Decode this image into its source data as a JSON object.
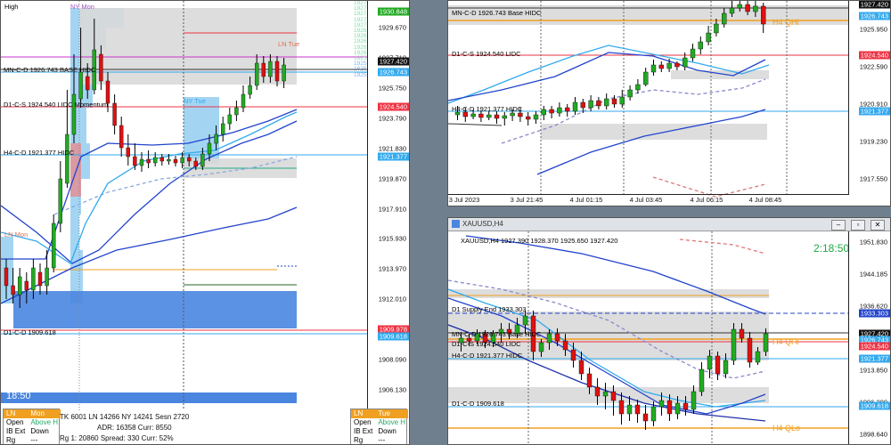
{
  "colors": {
    "bull": "#22aa22",
    "bear": "#dd1111",
    "blue": "#2244cc",
    "lightblue": "#33aaee",
    "orange": "#f0a020",
    "red": "#ee3344",
    "gray": "#d9d9d9",
    "zoneblue": "#4a86e0",
    "magenta": "#cc33cc",
    "hist": "#8ccbf0"
  },
  "left": {
    "high_label": "High",
    "ny_label": "NY Mon",
    "ln_tue_label": "LN Tue",
    "ny_tue_label": "NY Tue",
    "ln_mon_label": "LN Mon",
    "timer": "18:50",
    "zone_labels": [
      {
        "text": "MN-C-D 1926.743 BASE HIDC",
        "color": "#000"
      },
      {
        "text": "D1-C-S 1924.540 LIDC Momentum",
        "color": "#000"
      },
      {
        "text": "H4-C-D 1921.377 HIDC",
        "color": "#000"
      },
      {
        "text": "D1-C-D 1909.618",
        "color": "#000"
      }
    ],
    "ticks": [
      "1929.670",
      "1927.710",
      "1925.750",
      "1923.790",
      "1921.830",
      "1919.870",
      "1917.910",
      "1915.930",
      "1913.970",
      "1912.010",
      "1910.050",
      "1908.090",
      "1906.130"
    ],
    "tags": [
      {
        "text": "1930.848",
        "bg": "#22aa22"
      },
      {
        "text": "1927.420",
        "bg": "#111111"
      },
      {
        "text": "1926.743",
        "bg": "#33aaee"
      },
      {
        "text": "1924.540",
        "bg": "#ee3344"
      },
      {
        "text": "1921.377",
        "bg": "#33aaee"
      },
      {
        "text": "1909.978",
        "bg": "#ee3344"
      },
      {
        "text": "1909.618",
        "bg": "#33aaee"
      }
    ],
    "ladder": [
      {
        "price": "1927.850",
        "code": "A0"
      },
      {
        "price": "1927.650",
        "code": "A0"
      },
      {
        "price": "1927.450",
        "code": "A0"
      },
      {
        "price": "1927.250",
        "code": "A0"
      },
      {
        "price": "1927.050",
        "code": "A0"
      },
      {
        "price": "1926.850",
        "code": "A0"
      },
      {
        "price": "1926.650",
        "code": "A0"
      },
      {
        "price": "1926.450",
        "code": "A0"
      },
      {
        "price": "1926.250",
        "code": "A0"
      },
      {
        "price": "1926.050",
        "code": "A0"
      },
      {
        "price": "1925.850",
        "code": "A0"
      },
      {
        "price": "1925.650",
        "code": "B"
      },
      {
        "price": "1925.750",
        "code": "B"
      },
      {
        "price": "1925.650",
        "code": "D"
      }
    ],
    "panel_left": {
      "head": [
        "LN",
        "Mon"
      ],
      "rows": [
        [
          "Open",
          "Above H"
        ],
        [
          "IB Ext",
          "Down"
        ],
        [
          "Rg",
          "---"
        ]
      ]
    },
    "panel_mid": {
      "line1": "TK 6001  LN 14266  NY 14241  Sesn 2720",
      "line2": "ADR:  16358   Curr:   8550",
      "line3": "Rg 1: 20860  Spread: 330   Curr:   52%"
    },
    "panel_right": {
      "head": [
        "LN",
        "Tue"
      ],
      "rows": [
        [
          "Open",
          "Above H"
        ],
        [
          "IB Ext",
          "Down"
        ],
        [
          "Rg",
          "---"
        ]
      ]
    }
  },
  "topright": {
    "zone_labels": [
      {
        "text": "MN-C-D 1926.743 Base HIDC"
      },
      {
        "text": "D1-C-S 1924.540 LIDC"
      },
      {
        "text": "H4-C-D 1921.377 HIDC"
      }
    ],
    "qhi_label": "H4 QHi",
    "ticks": [
      "1925.950",
      "1922.590",
      "1920.910",
      "1919.230",
      "1917.550"
    ],
    "tags": [
      {
        "text": "1927.420",
        "bg": "#111111"
      },
      {
        "text": "1926.743",
        "bg": "#33aaee"
      },
      {
        "text": "1924.540",
        "bg": "#ee3344"
      },
      {
        "text": "1921.377",
        "bg": "#33aaee"
      }
    ],
    "xlabels": [
      "3 Jul 2023",
      "3 Jul 21:45",
      "4 Jul 01:15",
      "4 Jul 03:45",
      "4 Jul 06:15",
      "4 Jul 08:45"
    ]
  },
  "bottomright": {
    "title": "XAUUSD,H4",
    "ohlc": "XAUUSD,H4  1927.390 1928.370 1925.650 1927.420",
    "timer": "2:18:50",
    "zone_labels": [
      {
        "text": "D1 Supply End 1933.303"
      },
      {
        "text": "MN-C-D 1926.743 Base HIDC"
      },
      {
        "text": "D1-C-S 1924.540 LIDC"
      },
      {
        "text": "H4-C-D 1921.377 HIDC"
      },
      {
        "text": "D1-C-D 1909.618"
      }
    ],
    "qhi_label": "H4 QHi",
    "qlo_label": "H4 QLo",
    "ticks": [
      "1951.830",
      "1944.185",
      "1936.620",
      "1929.060",
      "1913.850",
      "1906.200",
      "1898.640"
    ],
    "tags": [
      {
        "text": "1933.303",
        "bg": "#2244cc"
      },
      {
        "text": "1927.420",
        "bg": "#111111"
      },
      {
        "text": "1926.743",
        "bg": "#33aaee"
      },
      {
        "text": "1924.540",
        "bg": "#ee3344"
      },
      {
        "text": "1921.377",
        "bg": "#33aaee"
      },
      {
        "text": "1909.618",
        "bg": "#33aaee"
      }
    ]
  }
}
